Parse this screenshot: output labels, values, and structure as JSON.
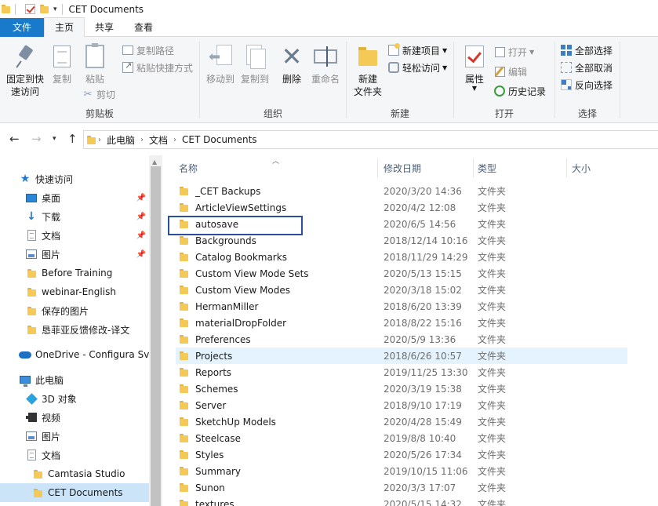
{
  "window": {
    "title": "CET Documents"
  },
  "tabs": [
    "文件",
    "主页",
    "共享",
    "查看"
  ],
  "ribbon": {
    "clipboard": {
      "label": "剪贴板",
      "pin": "固定到快速访问",
      "pin_line1": "固定到快",
      "pin_line2": "速访问",
      "copy": "复制",
      "paste": "粘贴",
      "copy_path": "复制路径",
      "paste_shortcut": "粘贴快捷方式",
      "cut": "剪切"
    },
    "organize": {
      "label": "组织",
      "move_to": "移动到",
      "copy_to": "复制到",
      "delete": "删除",
      "rename": "重命名"
    },
    "new": {
      "label": "新建",
      "new_folder_line1": "新建",
      "new_folder_line2": "文件夹",
      "new_item": "新建项目",
      "easy_access": "轻松访问"
    },
    "open": {
      "label": "打开",
      "properties": "属性",
      "open": "打开",
      "edit": "编辑",
      "history": "历史记录"
    },
    "select": {
      "label": "选择",
      "select_all": "全部选择",
      "select_none": "全部取消",
      "invert": "反向选择"
    }
  },
  "address": {
    "crumbs": [
      "此电脑",
      "文档",
      "CET Documents"
    ]
  },
  "nav": {
    "quick_access": "快速访问",
    "items": [
      {
        "label": "桌面",
        "icon": "desktop-icon",
        "pinned": true
      },
      {
        "label": "下载",
        "icon": "download-icon",
        "pinned": true
      },
      {
        "label": "文档",
        "icon": "document-icon",
        "pinned": true
      },
      {
        "label": "图片",
        "icon": "picture-icon",
        "pinned": true
      },
      {
        "label": "Before Training",
        "icon": "folder-icon"
      },
      {
        "label": "webinar-English",
        "icon": "folder-icon"
      },
      {
        "label": "保存的图片",
        "icon": "folder-icon"
      },
      {
        "label": "恳菲亚反馈修改-译文",
        "icon": "folder-icon"
      }
    ],
    "onedrive": "OneDrive - Configura Sve",
    "this_pc": "此电脑",
    "pc_items": [
      {
        "label": "3D 对象",
        "icon": "cube-icon"
      },
      {
        "label": "视频",
        "icon": "video-icon"
      },
      {
        "label": "图片",
        "icon": "picture-icon"
      },
      {
        "label": "文档",
        "icon": "document-icon"
      }
    ],
    "sub_items": [
      "Camtasia Studio",
      "CET Documents"
    ]
  },
  "columns": {
    "name": "名称",
    "date": "修改日期",
    "type": "类型",
    "size": "大小"
  },
  "files": [
    {
      "name": "_CET Backups",
      "date": "2020/3/20 14:36",
      "type": "文件夹"
    },
    {
      "name": "ArticleViewSettings",
      "date": "2020/4/2 12:08",
      "type": "文件夹"
    },
    {
      "name": "autosave",
      "date": "2020/6/5 14:56",
      "type": "文件夹"
    },
    {
      "name": "Backgrounds",
      "date": "2018/12/14 10:16",
      "type": "文件夹"
    },
    {
      "name": "Catalog Bookmarks",
      "date": "2018/11/29 14:29",
      "type": "文件夹"
    },
    {
      "name": "Custom View Mode Sets",
      "date": "2020/5/13 15:15",
      "type": "文件夹"
    },
    {
      "name": "Custom View Modes",
      "date": "2020/3/18 15:02",
      "type": "文件夹"
    },
    {
      "name": "HermanMiller",
      "date": "2018/6/20 13:39",
      "type": "文件夹"
    },
    {
      "name": "materialDropFolder",
      "date": "2018/8/22 15:16",
      "type": "文件夹"
    },
    {
      "name": "Preferences",
      "date": "2020/5/9 13:36",
      "type": "文件夹"
    },
    {
      "name": "Projects",
      "date": "2018/6/26 10:57",
      "type": "文件夹"
    },
    {
      "name": "Reports",
      "date": "2019/11/25 13:30",
      "type": "文件夹"
    },
    {
      "name": "Schemes",
      "date": "2020/3/19 15:38",
      "type": "文件夹"
    },
    {
      "name": "Server",
      "date": "2018/9/10 17:19",
      "type": "文件夹"
    },
    {
      "name": "SketchUp Models",
      "date": "2020/4/28 15:49",
      "type": "文件夹"
    },
    {
      "name": "Steelcase",
      "date": "2019/8/8 10:40",
      "type": "文件夹"
    },
    {
      "name": "Styles",
      "date": "2020/5/26 17:34",
      "type": "文件夹"
    },
    {
      "name": "Summary",
      "date": "2019/10/15 11:06",
      "type": "文件夹"
    },
    {
      "name": "Sunon",
      "date": "2020/3/3 17:07",
      "type": "文件夹"
    },
    {
      "name": "textures",
      "date": "2020/5/15 14:32",
      "type": "文件夹"
    }
  ],
  "colors": {
    "accent": "#1979ca",
    "selection": "#cce4f7",
    "hover": "#e5f3ff",
    "annotation": "#2b4ea3"
  }
}
